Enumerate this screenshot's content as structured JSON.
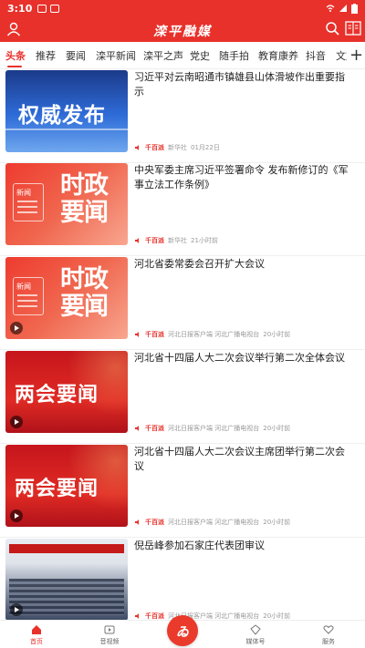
{
  "status": {
    "time": "3:10"
  },
  "header": {
    "title": "滦平融媒"
  },
  "tabs": [
    "头条",
    "推荐",
    "要闻",
    "滦平新闻",
    "滦平之声",
    "党史",
    "随手拍",
    "教育康养",
    "抖音",
    "文旅"
  ],
  "articles": [
    {
      "headline": "习近平对云南昭通市镇雄县山体滑坡作出重要指示",
      "badge": "千百派",
      "source": "新华社",
      "time": "01月22日",
      "thumb_text": "权威发布",
      "play": false
    },
    {
      "headline": "中央军委主席习近平签署命令 发布新修订的《军事立法工作条例》",
      "badge": "千百派",
      "source": "新华社",
      "time": "21小时前",
      "thumb_text": "时政要闻",
      "thumb_doc": "新闻",
      "play": false
    },
    {
      "headline": "河北省委常委会召开扩大会议",
      "badge": "千百派",
      "source": "河北日报客户端 河北广播电视台",
      "time": "20小时前",
      "thumb_text": "时政要闻",
      "thumb_doc": "新闻",
      "play": true
    },
    {
      "headline": "河北省十四届人大二次会议举行第二次全体会议",
      "badge": "千百派",
      "source": "河北日报客户端 河北广播电视台",
      "time": "20小时前",
      "thumb_text": "两会要闻",
      "play": true
    },
    {
      "headline": "河北省十四届人大二次会议主席团举行第二次会议",
      "badge": "千百派",
      "source": "河北日报客户端 河北广播电视台",
      "time": "20小时前",
      "thumb_text": "两会要闻",
      "play": true
    },
    {
      "headline": "倪岳峰参加石家庄代表团审议",
      "badge": "千百派",
      "source": "河北日报客户端 河北广播电视台",
      "time": "20小时前",
      "thumb_text": "",
      "play": true
    }
  ],
  "bottom_nav": {
    "home": "首页",
    "video": "音视频",
    "media": "媒体号",
    "service": "服务"
  },
  "colors": {
    "brand": "#e8312b"
  }
}
